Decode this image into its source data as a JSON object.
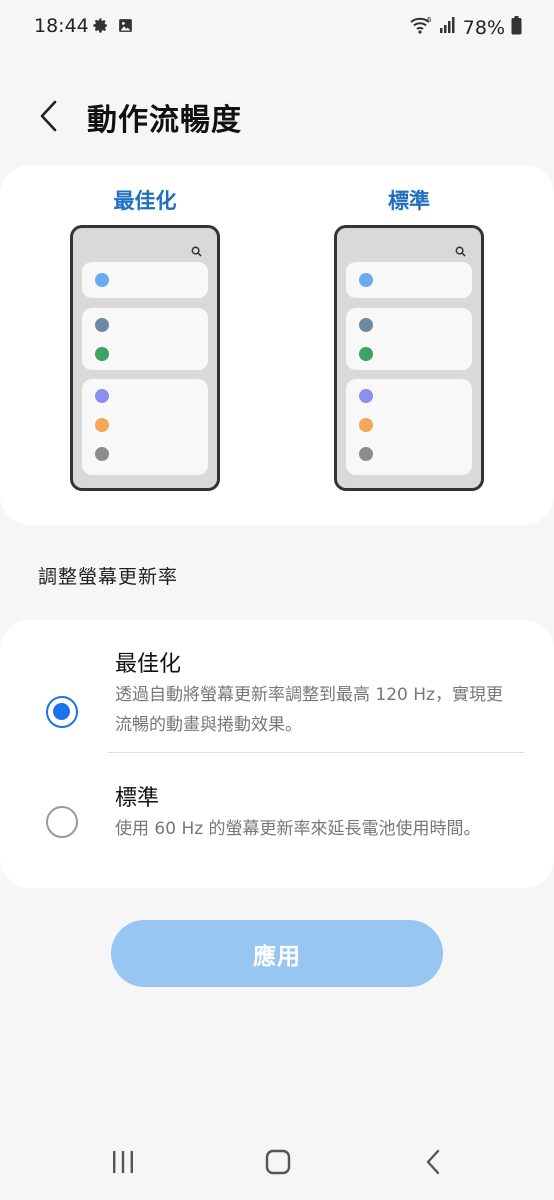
{
  "status_bar": {
    "time": "18:44",
    "battery": "78%",
    "icons": [
      "gear-icon",
      "image-icon",
      "wifi-icon",
      "signal-icon",
      "battery-icon"
    ]
  },
  "header": {
    "title": "動作流暢度"
  },
  "preview": {
    "left_label": "最佳化",
    "right_label": "標準",
    "dot_colors": [
      "#6aaaf4",
      "#6d8aa3",
      "#3aa365",
      "#8c8ef0",
      "#f5a756",
      "#8c8c8c"
    ]
  },
  "section": {
    "label": "調整螢幕更新率"
  },
  "options": [
    {
      "title": "最佳化",
      "description": "透過自動將螢幕更新率調整到最高 120 Hz，實現更流暢的動畫與捲動效果。",
      "selected": true
    },
    {
      "title": "標準",
      "description": "使用 60 Hz 的螢幕更新率來延長電池使用時間。",
      "selected": false
    }
  ],
  "apply_button": {
    "label": "應用"
  },
  "nav": {
    "icons": [
      "recent-apps-icon",
      "home-icon",
      "back-icon"
    ]
  },
  "colors": {
    "accent": "#1a73e8",
    "apply_disabled": "#98c6f3",
    "preview_label": "#1f6fc0"
  }
}
